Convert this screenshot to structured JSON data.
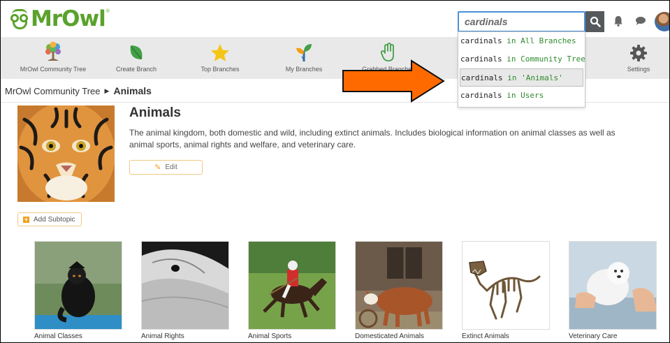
{
  "header": {
    "logo_text": "MrOwl",
    "search": {
      "value": "cardinals",
      "placeholder": ""
    },
    "icons": [
      "search-icon",
      "bell-icon",
      "chat-icon",
      "avatar"
    ]
  },
  "toolbar": {
    "items": [
      {
        "label": "MrOwl Community Tree",
        "icon": "tree-icon"
      },
      {
        "label": "Create Branch",
        "icon": "leaf-icon"
      },
      {
        "label": "Top Branches",
        "icon": "star-icon"
      },
      {
        "label": "My Branches",
        "icon": "sprout-icon"
      },
      {
        "label": "Grabbed Branches",
        "icon": "hand-icon"
      },
      {
        "label": "Settings",
        "icon": "gear-icon"
      }
    ]
  },
  "search_suggestions": [
    {
      "term": "cardinals",
      "scope": "in All Branches",
      "selected": false
    },
    {
      "term": "cardinals",
      "scope": "in Community Tree",
      "selected": false
    },
    {
      "term": "cardinals",
      "scope": "in 'Animals'",
      "selected": true
    },
    {
      "term": "cardinals",
      "scope": "in Users",
      "selected": false
    }
  ],
  "breadcrumb": {
    "root": "MrOwl Community Tree",
    "current": "Animals"
  },
  "topic": {
    "title": "Animals",
    "description": "The animal kingdom, both domestic and wild, including extinct animals. Includes biological information on animal classes as well as animal sports, animal rights and welfare, and veterinary care.",
    "edit_label": "Edit",
    "add_subtopic_label": "Add Subtopic"
  },
  "subtopics": [
    {
      "label": "Animal Classes"
    },
    {
      "label": "Animal Rights"
    },
    {
      "label": "Animal Sports"
    },
    {
      "label": "Domesticated Animals"
    },
    {
      "label": "Extinct Animals"
    },
    {
      "label": "Veterinary Care"
    }
  ],
  "colors": {
    "brand_green": "#5aa22c",
    "toolbar_bg": "#e9e9e9",
    "search_border": "#4a90d9",
    "suggestion_scope": "#2e8b2e",
    "arrow": "#ff6a00",
    "button_border": "#f0c987"
  }
}
